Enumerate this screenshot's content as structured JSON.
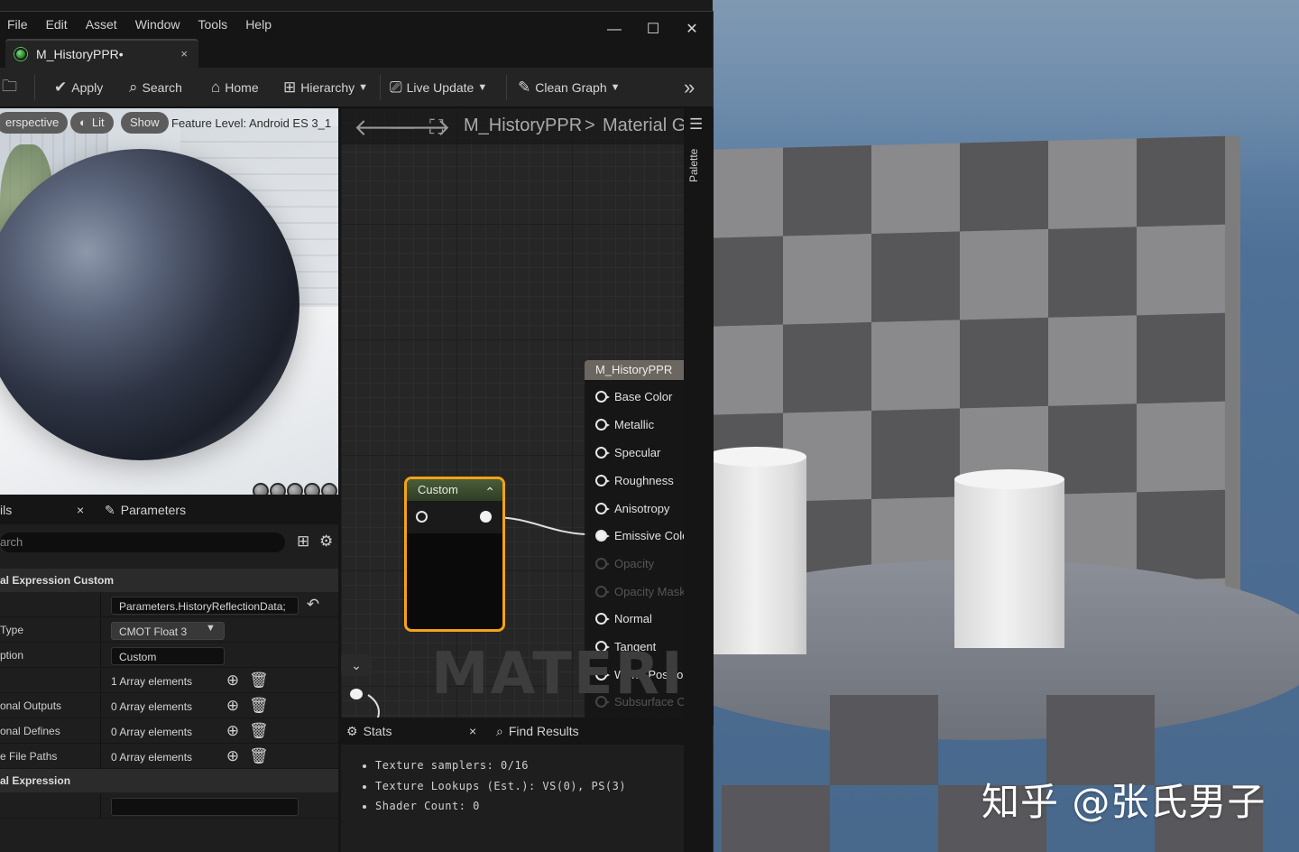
{
  "menu": [
    "File",
    "Edit",
    "Asset",
    "Window",
    "Tools",
    "Help"
  ],
  "window_controls": {
    "minimize": "—",
    "maximize": "☐",
    "close": "✕"
  },
  "document_tab": {
    "label": "M_HistoryPPR•",
    "close": "×"
  },
  "toolbar": {
    "apply": "Apply",
    "search": "Search",
    "home": "Home",
    "hierarchy": "Hierarchy",
    "live_update": "Live Update",
    "clean_graph": "Clean Graph"
  },
  "preview": {
    "perspective": "erspective",
    "lit": "Lit",
    "show": "Show",
    "feature_level": "Feature Level:  Android ES 3_1"
  },
  "details": {
    "tab_details": "ils",
    "tab_close": "×",
    "tab_parameters": "Parameters",
    "search_placeholder": "arch",
    "section_custom": "al Expression Custom",
    "rows": [
      {
        "label": "",
        "value": "Parameters.HistoryReflectionData;"
      },
      {
        "label": " Type",
        "value": "CMOT Float 3"
      },
      {
        "label": "ption",
        "value": "Custom"
      },
      {
        "label": "",
        "value": "1 Array elements"
      },
      {
        "label": "onal Outputs",
        "value": "0 Array elements"
      },
      {
        "label": "onal Defines",
        "value": "0 Array elements"
      },
      {
        "label": "e File Paths",
        "value": "0 Array elements"
      }
    ],
    "section_expression": "al Expression"
  },
  "graph": {
    "breadcrumb_root": "M_HistoryPPR",
    "breadcrumb_sep": ">",
    "breadcrumb_current": "Material Gr",
    "material_node": {
      "title": "M_HistoryPPR",
      "pins": [
        {
          "label": "Base Color",
          "state": "normal"
        },
        {
          "label": "Metallic",
          "state": "normal"
        },
        {
          "label": "Specular",
          "state": "normal"
        },
        {
          "label": "Roughness",
          "state": "normal"
        },
        {
          "label": "Anisotropy",
          "state": "normal"
        },
        {
          "label": "Emissive Color",
          "state": "connected"
        },
        {
          "label": "Opacity",
          "state": "disabled"
        },
        {
          "label": "Opacity Mask",
          "state": "disabled"
        },
        {
          "label": "Normal",
          "state": "normal"
        },
        {
          "label": "Tangent",
          "state": "normal"
        },
        {
          "label": "World Position Offset",
          "state": "normal"
        },
        {
          "label": "Subsurface Color",
          "state": "disabled"
        }
      ]
    },
    "custom_node": {
      "title": "Custom"
    },
    "watermark": "MATERIAL",
    "palette": "Palette"
  },
  "stats": {
    "tab_stats": "Stats",
    "tab_close": "×",
    "tab_find": "Find Results",
    "lines": [
      "Texture samplers: 0/16",
      "Texture Lookups (Est.): VS(0), PS(3)",
      "Shader Count: 0"
    ]
  },
  "scene": {
    "watermark": "知乎 @张氏男子"
  },
  "colors": {
    "selection_outline": "#f2a318",
    "graph_bg": "#262626",
    "sky": "#5d7fa3"
  }
}
